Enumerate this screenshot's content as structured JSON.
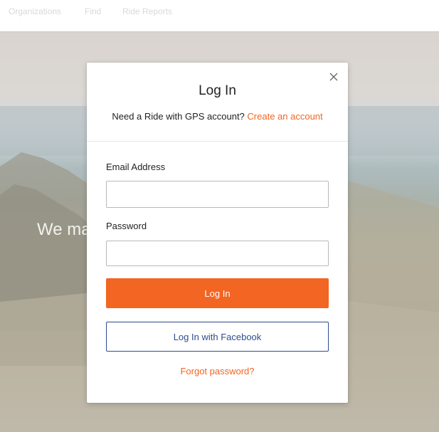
{
  "nav": {
    "items": [
      {
        "label": "Organizations"
      },
      {
        "label": "Find"
      },
      {
        "label": "Ride Reports"
      }
    ]
  },
  "hero": {
    "headline": "We ma                                                     d, and"
  },
  "modal": {
    "title": "Log In",
    "subtitle_prefix": "Need a Ride with GPS account? ",
    "create_account_link": "Create an account",
    "close_icon": "close-icon",
    "email_label": "Email Address",
    "email_value": "",
    "password_label": "Password",
    "password_value": "",
    "login_button": "Log In",
    "facebook_button": "Log In with Facebook",
    "forgot_password": "Forgot password?"
  },
  "colors": {
    "accent": "#f26522",
    "facebook": "#2d4d8c",
    "text": "#222222"
  }
}
